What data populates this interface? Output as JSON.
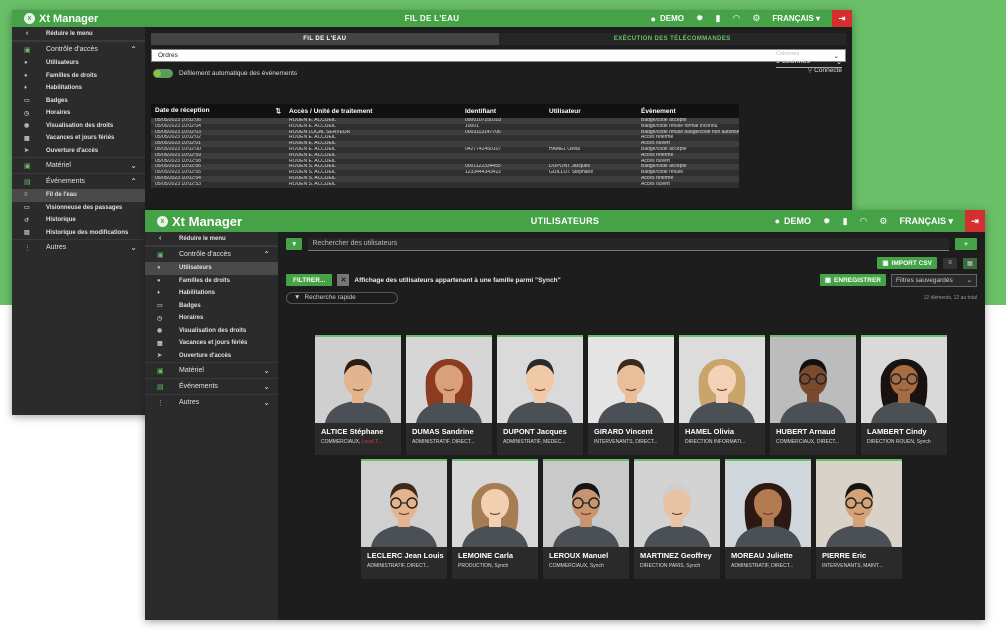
{
  "app": {
    "name": "Xt Manager",
    "user": "DEMO",
    "language": "FRANÇAIS"
  },
  "back_window": {
    "title": "FIL DE L'EAU",
    "sidebar": {
      "reduce": "Réduire le menu",
      "sections": [
        {
          "label": "Contrôle d'accès",
          "items": [
            "Utilisateurs",
            "Familles de droits",
            "Habilitations",
            "Badges",
            "Horaires",
            "Visualisation des droits",
            "Vacances et jours fériés",
            "Ouverture d'accès"
          ]
        },
        {
          "label": "Matériel"
        },
        {
          "label": "Événements",
          "items": [
            "Fil de l'eau",
            "Visionneuse des passages",
            "Historique",
            "Historique des modifications"
          ]
        },
        {
          "label": "Autres"
        }
      ]
    },
    "tabs": [
      "FIL DE L'EAU",
      "EXÉCUTION DES TÉLÉCOMMANDES"
    ],
    "filter_value": "Ordres",
    "toggle_label": "Défilement automatique des événements",
    "status": "Connecté",
    "columns_label": "Colonnes",
    "columns_value": "5 colonnes",
    "table": {
      "headers": [
        "Date de réception",
        "Accès / Unité de traitement",
        "Identifiant",
        "Utilisateur",
        "Évènement"
      ],
      "rows": [
        [
          "05/05/2023 10:02:06",
          "ROUEN E. ACCUEIL",
          "0000107250103",
          "",
          "Badge/code accepté"
        ],
        [
          "05/05/2023 10:02:04",
          "ROUEN E. ACCUEIL",
          "10001",
          "",
          "Badge/code refusé format inconnu"
        ],
        [
          "05/05/2023 10:02:03",
          "ROUEN LOCAL SERVEUR",
          "0003113147706",
          "",
          "Badge/code refusé badge/code non autorisé"
        ],
        [
          "05/05/2023 10:02:02",
          "ROUEN E. ACCUEIL",
          "",
          "",
          "Accès refermé"
        ],
        [
          "05/05/2023 10:02:01",
          "ROUEN E. ACCUEIL",
          "",
          "",
          "Accès ouvert"
        ],
        [
          "05/05/2023 10:02:00",
          "ROUEN E. ACCUEIL",
          "0427742450107",
          "HAMEL Olivia",
          "Badge/code accepté"
        ],
        [
          "05/05/2023 10:02:59",
          "ROUEN E. ACCUEIL",
          "",
          "",
          "Accès refermé"
        ],
        [
          "05/05/2023 10:02:58",
          "ROUEN E. ACCUEIL",
          "",
          "",
          "Accès ouvert"
        ],
        [
          "05/05/2023 10:02:56",
          "ROUEN S. ACCUEIL",
          "0001122334455",
          "DUPONT Jacques",
          "Badge/code accepté"
        ],
        [
          "05/05/2023 10:02:55",
          "ROUEN S. ACCUEIL",
          "1233444343422",
          "GUILLOT Stéphane",
          "Badge/code refusé"
        ],
        [
          "05/05/2023 10:02:54",
          "ROUEN S. ACCUEIL",
          "",
          "",
          "Accès refermé"
        ],
        [
          "05/05/2023 10:02:53",
          "ROUEN S. ACCUEIL",
          "",
          "",
          "Accès ouvert"
        ]
      ]
    }
  },
  "front_window": {
    "title": "UTILISATEURS",
    "sidebar": {
      "reduce": "Réduire le menu",
      "sections": [
        {
          "label": "Contrôle d'accès",
          "items": [
            "Utilisateurs",
            "Familles de droits",
            "Habilitations",
            "Badges",
            "Horaires",
            "Visualisation des droits",
            "Vacances et jours fériés",
            "Ouverture d'accès"
          ]
        },
        {
          "label": "Matériel"
        },
        {
          "label": "Événements"
        },
        {
          "label": "Autres"
        }
      ]
    },
    "search_placeholder": "Rechercher des utilisateurs",
    "add_label": "+",
    "import_label": "IMPORT CSV",
    "filter_button": "FILTRER...",
    "filter_text": "Affichage des utilisateurs appartenant à une famille parmi \"Synch\"",
    "save_label": "ENREGISTRER",
    "saved_filters": "Filtres sauvegardés",
    "quick_search": "Recherche rapide",
    "count_text": "12 éléments, 12 au total",
    "users": [
      {
        "name": "ALTICE Stéphane",
        "role": "COMMERCIAUX, ",
        "role_red": "Local T..."
      },
      {
        "name": "DUMAS Sandrine",
        "role": "ADMINISTRATIF, DIRECT..."
      },
      {
        "name": "DUPONT Jacques",
        "role": "ADMINISTRATIF, MEDEC..."
      },
      {
        "name": "GIRARD Vincent",
        "role": "INTERVENANTS, DIRECT..."
      },
      {
        "name": "HAMEL Olivia",
        "role": "DIRECTION INFORMATI..."
      },
      {
        "name": "HUBERT Arnaud",
        "role": "COMMERCIAUX, DIRECT..."
      },
      {
        "name": "LAMBERT Cindy",
        "role": "DIRECTION ROUEN, Synch"
      },
      {
        "name": "LECLERC Jean Louis",
        "role": "ADMINISTRATIF, DIRECT..."
      },
      {
        "name": "LEMOINE Carla",
        "role": "PRODUCTION, Synch"
      },
      {
        "name": "LEROUX Manuel",
        "role": "COMMERCIAUX, Synch"
      },
      {
        "name": "MARTINEZ Geoffrey",
        "role": "DIRECTION PARIS, Synch"
      },
      {
        "name": "MOREAU Juliette",
        "role": "ADMINISTRATIF, DIRECT..."
      },
      {
        "name": "PIERRE Eric",
        "role": "INTERVENANTS, MAINT..."
      }
    ]
  },
  "colors": {
    "brand": "#45a247",
    "background_green": "#6abf69",
    "exit": "#d32f2f"
  }
}
